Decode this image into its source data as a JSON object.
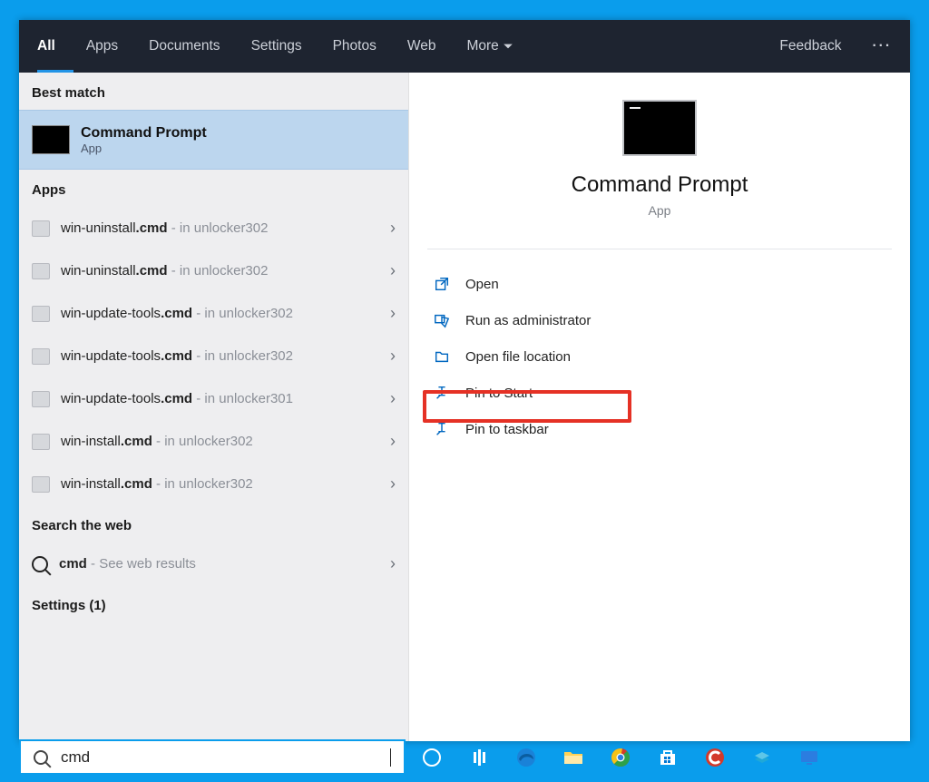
{
  "tabs": {
    "all": "All",
    "apps": "Apps",
    "documents": "Documents",
    "settings": "Settings",
    "photos": "Photos",
    "web": "Web",
    "more": "More",
    "feedback": "Feedback"
  },
  "sections": {
    "best": "Best match",
    "apps": "Apps",
    "web": "Search the web",
    "settings": "Settings (1)"
  },
  "bestMatch": {
    "title": "Command Prompt",
    "type": "App"
  },
  "appResults": [
    {
      "name": "win-uninstall",
      "ext": ".cmd",
      "loc": "in unlocker302"
    },
    {
      "name": "win-uninstall",
      "ext": ".cmd",
      "loc": "in unlocker302"
    },
    {
      "name": "win-update-tools",
      "ext": ".cmd",
      "loc": "in unlocker302"
    },
    {
      "name": "win-update-tools",
      "ext": ".cmd",
      "loc": "in unlocker302"
    },
    {
      "name": "win-update-tools",
      "ext": ".cmd",
      "loc": "in unlocker301"
    },
    {
      "name": "win-install",
      "ext": ".cmd",
      "loc": "in unlocker302"
    },
    {
      "name": "win-install",
      "ext": ".cmd",
      "loc": "in unlocker302"
    }
  ],
  "webResult": {
    "query": "cmd",
    "hint": "See web results"
  },
  "preview": {
    "title": "Command Prompt",
    "type": "App"
  },
  "actions": {
    "open": "Open",
    "admin": "Run as administrator",
    "fileloc": "Open file location",
    "pinstart": "Pin to Start",
    "pintask": "Pin to taskbar"
  },
  "search": {
    "value": "cmd"
  }
}
